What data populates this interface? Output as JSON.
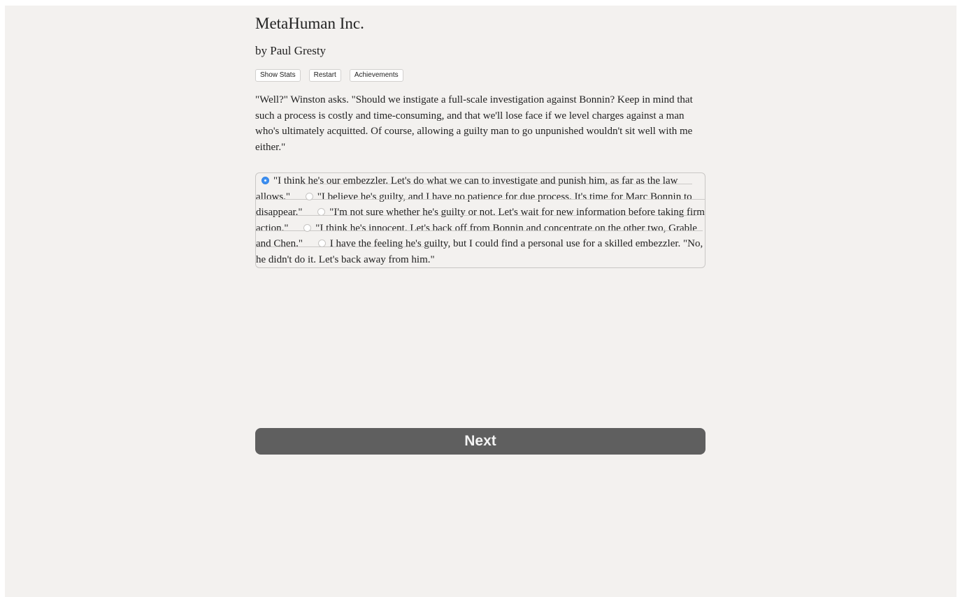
{
  "header": {
    "title": "MetaHuman Inc.",
    "author": "by Paul Gresty"
  },
  "toolbar": {
    "show_stats_label": "Show Stats",
    "restart_label": "Restart",
    "achievements_label": "Achievements"
  },
  "narrative": "\"Well?\" Winston asks. \"Should we instigate a full-scale investigation against Bonnin? Keep in mind that such a process is costly and time-consuming, and that we'll lose face if we level charges against a man who's ultimately acquitted. Of course, allowing a guilty man to go unpunished wouldn't sit well with me either.\"",
  "choices": [
    {
      "label": "\"I think he's our embezzler. Let's do what we can to investigate and punish him, as far as the law allows.\"",
      "selected": true
    },
    {
      "label": "\"I believe he's guilty, and I have no patience for due process. It's time for Marc Bonnin to disappear.\"",
      "selected": false
    },
    {
      "label": "\"I'm not sure whether he's guilty or not. Let's wait for new information before taking firm action.\"",
      "selected": false
    },
    {
      "label": "\"I think he's innocent. Let's back off from Bonnin and concentrate on the other two, Grable and Chen.\"",
      "selected": false
    },
    {
      "label": "I have the feeling he's guilty, but I could find a personal use for a skilled embezzler. \"No, he didn't do it. Let's back away from him.\"",
      "selected": false
    }
  ],
  "next_label": "Next",
  "colors": {
    "background": "#f3f1ef",
    "radio_selected": "#3d8ff0",
    "next_button": "#5f5f5f"
  }
}
